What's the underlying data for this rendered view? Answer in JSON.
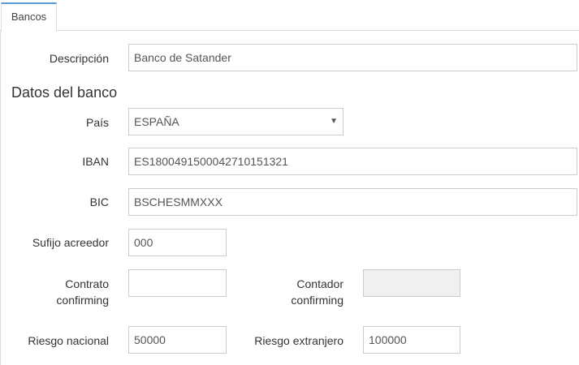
{
  "tabs": [
    {
      "label": "Bancos",
      "active": true
    }
  ],
  "form": {
    "descripcion_label": "Descripción",
    "descripcion_value": "Banco de Satander",
    "section_title": "Datos del banco",
    "pais_label": "País",
    "pais_value": "ESPAÑA",
    "iban_label": "IBAN",
    "iban_value": "ES1800491500042710151321",
    "bic_label": "BIC",
    "bic_value": "BSCHESMMXXX",
    "sufijo_label": "Sufijo acreedor",
    "sufijo_value": "000",
    "contrato_label_line1": "Contrato",
    "contrato_label_line2": "confirming",
    "contrato_value": "",
    "contador_label_line1": "Contador",
    "contador_label_line2": "confirming",
    "contador_value": "",
    "riesgo_nacional_label": "Riesgo nacional",
    "riesgo_nacional_value": "50000",
    "riesgo_extranjero_label": "Riesgo extranjero",
    "riesgo_extranjero_value": "100000"
  },
  "icons": {
    "select_arrow": "chevron-down-icon"
  },
  "colors": {
    "tab_accent": "#5b9bd5",
    "border": "#cccccc",
    "disabled_bg": "#f0f0f0"
  }
}
